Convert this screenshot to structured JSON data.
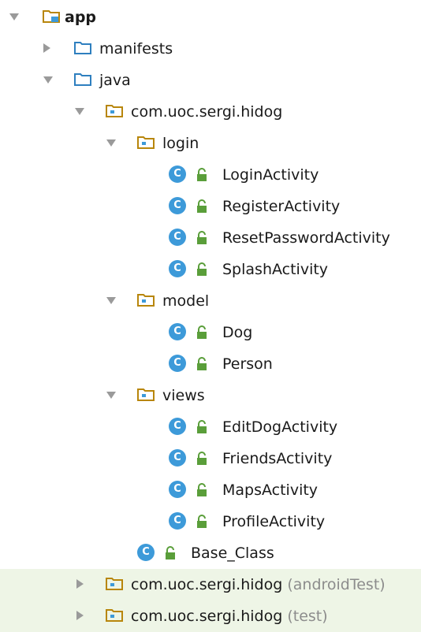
{
  "tree": {
    "root": {
      "label": "app"
    },
    "manifests": {
      "label": "manifests"
    },
    "java": {
      "label": "java"
    },
    "main_pkg": {
      "label": "com.uoc.sergi.hidog"
    },
    "login": {
      "label": "login",
      "classes": [
        "LoginActivity",
        "RegisterActivity",
        "ResetPasswordActivity",
        "SplashActivity"
      ]
    },
    "model": {
      "label": "model",
      "classes": [
        "Dog",
        "Person"
      ]
    },
    "views": {
      "label": "views",
      "classes": [
        "EditDogActivity",
        "FriendsActivity",
        "MapsActivity",
        "ProfileActivity"
      ]
    },
    "base_class": {
      "label": "Base_Class"
    },
    "android_test_pkg": {
      "label": "com.uoc.sergi.hidog",
      "suffix": "(androidTest)"
    },
    "test_pkg": {
      "label": "com.uoc.sergi.hidog",
      "suffix": "(test)"
    }
  },
  "icons": {
    "class_icon_glyph": "C",
    "class_icon_color": "#3d9ad9",
    "folder_color": "#2e7fbf",
    "package_color": "#b8860b",
    "lock_color": "#5a9e3a",
    "highlight_color": "#eef5e6"
  }
}
